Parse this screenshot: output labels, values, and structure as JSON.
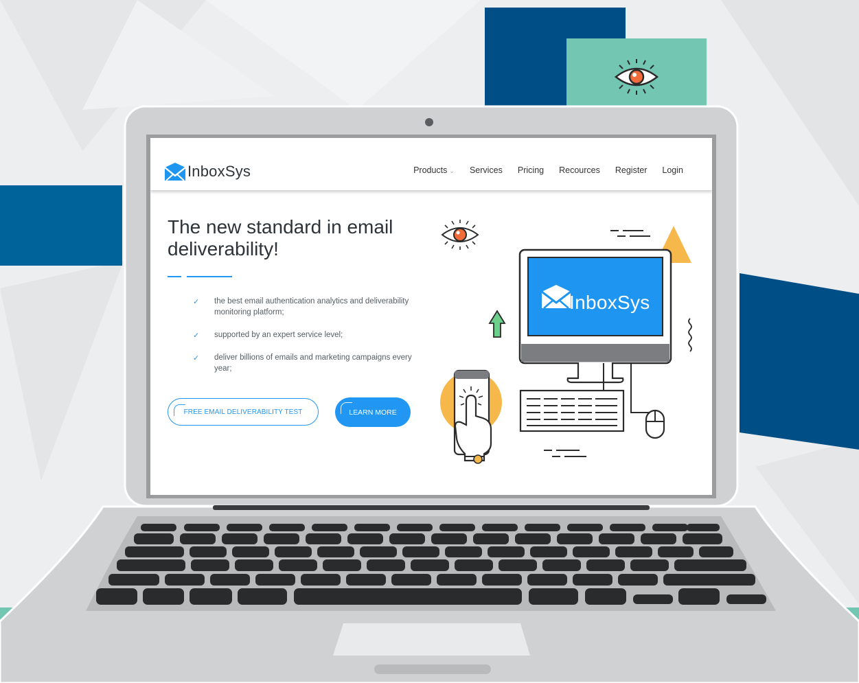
{
  "nav": {
    "brand": "InboxSys",
    "items": [
      {
        "label": "Products",
        "has_dropdown": true
      },
      {
        "label": "Services"
      },
      {
        "label": "Pricing"
      },
      {
        "label": "Recources"
      },
      {
        "label": "Register"
      },
      {
        "label": "Login"
      }
    ],
    "dropdown_caret": "⌄"
  },
  "hero": {
    "title": "The new standard in email deliverability!",
    "bullets": [
      "the best email authentication analytics and deliverability monitoring platform;",
      "supported by an expert service level;",
      "deliver billions of emails and marketing campaigns every year;"
    ],
    "check_glyph": "✓",
    "primary_cta": "FREE EMAIL DELIVERABILITY TEST",
    "secondary_cta": "LEARN MORE"
  },
  "illustration": {
    "monitor_brand": "InboxSys"
  },
  "colors": {
    "accent": "#2196f3",
    "dark_blue": "#004e86",
    "teal": "#72c6b2",
    "orange": "#f26b3a",
    "yellow": "#f7b84b",
    "green": "#6ccf8a"
  }
}
